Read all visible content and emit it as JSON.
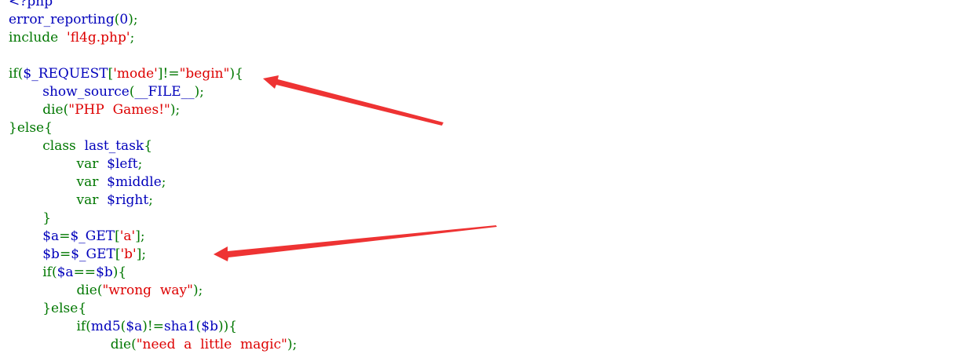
{
  "code": {
    "lines": [
      {
        "tokens": [
          {
            "t": "<?php",
            "c": "fn"
          }
        ]
      },
      {
        "tokens": [
          {
            "t": "error_reporting",
            "c": "fn"
          },
          {
            "t": "(",
            "c": "punc"
          },
          {
            "t": "0",
            "c": "fn"
          },
          {
            "t": ");",
            "c": "punc"
          }
        ]
      },
      {
        "tokens": [
          {
            "t": "include  ",
            "c": "kw"
          },
          {
            "t": "'fl4g.php'",
            "c": "str"
          },
          {
            "t": ";",
            "c": "punc"
          }
        ]
      },
      {
        "tokens": []
      },
      {
        "tokens": [
          {
            "t": "if(",
            "c": "kw"
          },
          {
            "t": "$_REQUEST",
            "c": "fn"
          },
          {
            "t": "[",
            "c": "punc"
          },
          {
            "t": "'mode'",
            "c": "str"
          },
          {
            "t": "]!=",
            "c": "punc"
          },
          {
            "t": "\"begin\"",
            "c": "str"
          },
          {
            "t": "){",
            "c": "punc"
          }
        ]
      },
      {
        "tokens": [
          {
            "t": "        ",
            "c": "fn"
          },
          {
            "t": "show_source",
            "c": "fn"
          },
          {
            "t": "(",
            "c": "punc"
          },
          {
            "t": "__FILE__",
            "c": "fn"
          },
          {
            "t": ");",
            "c": "punc"
          }
        ]
      },
      {
        "tokens": [
          {
            "t": "        ",
            "c": "fn"
          },
          {
            "t": "die(",
            "c": "kw"
          },
          {
            "t": "\"PHP  Games!\"",
            "c": "str"
          },
          {
            "t": ");",
            "c": "punc"
          }
        ]
      },
      {
        "tokens": [
          {
            "t": "}else{",
            "c": "punc"
          }
        ]
      },
      {
        "tokens": [
          {
            "t": "        ",
            "c": "fn"
          },
          {
            "t": "class  ",
            "c": "kw"
          },
          {
            "t": "last_task",
            "c": "fn"
          },
          {
            "t": "{",
            "c": "punc"
          }
        ]
      },
      {
        "tokens": [
          {
            "t": "                ",
            "c": "fn"
          },
          {
            "t": "var  ",
            "c": "kw"
          },
          {
            "t": "$left",
            "c": "fn"
          },
          {
            "t": ";",
            "c": "punc"
          }
        ]
      },
      {
        "tokens": [
          {
            "t": "                ",
            "c": "fn"
          },
          {
            "t": "var  ",
            "c": "kw"
          },
          {
            "t": "$middle",
            "c": "fn"
          },
          {
            "t": ";",
            "c": "punc"
          }
        ]
      },
      {
        "tokens": [
          {
            "t": "                ",
            "c": "fn"
          },
          {
            "t": "var  ",
            "c": "kw"
          },
          {
            "t": "$right",
            "c": "fn"
          },
          {
            "t": ";",
            "c": "punc"
          }
        ]
      },
      {
        "tokens": [
          {
            "t": "        ",
            "c": "fn"
          },
          {
            "t": "}",
            "c": "punc"
          }
        ]
      },
      {
        "tokens": [
          {
            "t": "        ",
            "c": "fn"
          },
          {
            "t": "$a",
            "c": "fn"
          },
          {
            "t": "=",
            "c": "punc"
          },
          {
            "t": "$_GET",
            "c": "fn"
          },
          {
            "t": "[",
            "c": "punc"
          },
          {
            "t": "'a'",
            "c": "str"
          },
          {
            "t": "];",
            "c": "punc"
          }
        ]
      },
      {
        "tokens": [
          {
            "t": "        ",
            "c": "fn"
          },
          {
            "t": "$b",
            "c": "fn"
          },
          {
            "t": "=",
            "c": "punc"
          },
          {
            "t": "$_GET",
            "c": "fn"
          },
          {
            "t": "[",
            "c": "punc"
          },
          {
            "t": "'b'",
            "c": "str"
          },
          {
            "t": "];",
            "c": "punc"
          }
        ]
      },
      {
        "tokens": [
          {
            "t": "        ",
            "c": "fn"
          },
          {
            "t": "if(",
            "c": "kw"
          },
          {
            "t": "$a",
            "c": "fn"
          },
          {
            "t": "==",
            "c": "punc"
          },
          {
            "t": "$b",
            "c": "fn"
          },
          {
            "t": "){",
            "c": "punc"
          }
        ]
      },
      {
        "tokens": [
          {
            "t": "                ",
            "c": "fn"
          },
          {
            "t": "die(",
            "c": "kw"
          },
          {
            "t": "\"wrong  way\"",
            "c": "str"
          },
          {
            "t": ");",
            "c": "punc"
          }
        ]
      },
      {
        "tokens": [
          {
            "t": "        ",
            "c": "fn"
          },
          {
            "t": "}else{",
            "c": "punc"
          }
        ]
      },
      {
        "tokens": [
          {
            "t": "                ",
            "c": "fn"
          },
          {
            "t": "if(",
            "c": "kw"
          },
          {
            "t": "md5",
            "c": "fn"
          },
          {
            "t": "(",
            "c": "punc"
          },
          {
            "t": "$a",
            "c": "fn"
          },
          {
            "t": ")!=",
            "c": "punc"
          },
          {
            "t": "sha1",
            "c": "fn"
          },
          {
            "t": "(",
            "c": "punc"
          },
          {
            "t": "$b",
            "c": "fn"
          },
          {
            "t": ")){",
            "c": "punc"
          }
        ]
      },
      {
        "tokens": [
          {
            "t": "                        ",
            "c": "fn"
          },
          {
            "t": "die(",
            "c": "kw"
          },
          {
            "t": "\"need  a  little  magic\"",
            "c": "str"
          },
          {
            "t": ");",
            "c": "punc"
          }
        ]
      }
    ]
  },
  "colors": {
    "keyword": "#007700",
    "default": "#0000bb",
    "string": "#dd0000",
    "annotation_arrow": "#ee3333"
  }
}
